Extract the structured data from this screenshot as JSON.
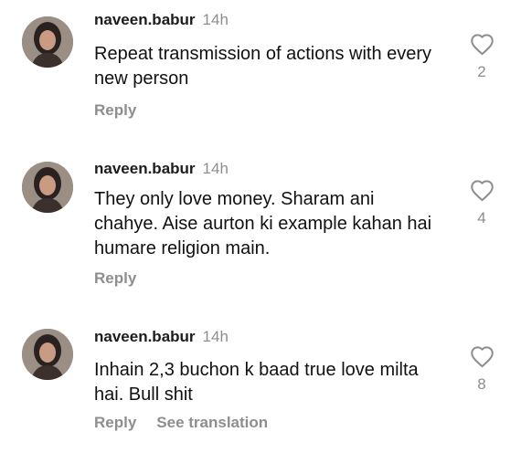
{
  "comments": [
    {
      "username": "naveen.babur",
      "time": "14h",
      "text": "Repeat transmission of actions with every new person",
      "likes": "2",
      "reply_label": "Reply"
    },
    {
      "username": "naveen.babur",
      "time": "14h",
      "text": "They only love money. Sharam ani chahye. Aise aurton ki example kahan hai humare religion main.",
      "likes": "4",
      "reply_label": "Reply"
    },
    {
      "username": "naveen.babur",
      "time": "14h",
      "text": "Inhain 2,3 buchon k baad true love milta hai. Bull shit",
      "likes": "8",
      "reply_label": "Reply",
      "translate_label": "See translation"
    }
  ],
  "icons": {
    "like": "heart-outline-icon"
  },
  "colors": {
    "secondary_text": "#8e8e8e",
    "primary_text": "#111111"
  }
}
